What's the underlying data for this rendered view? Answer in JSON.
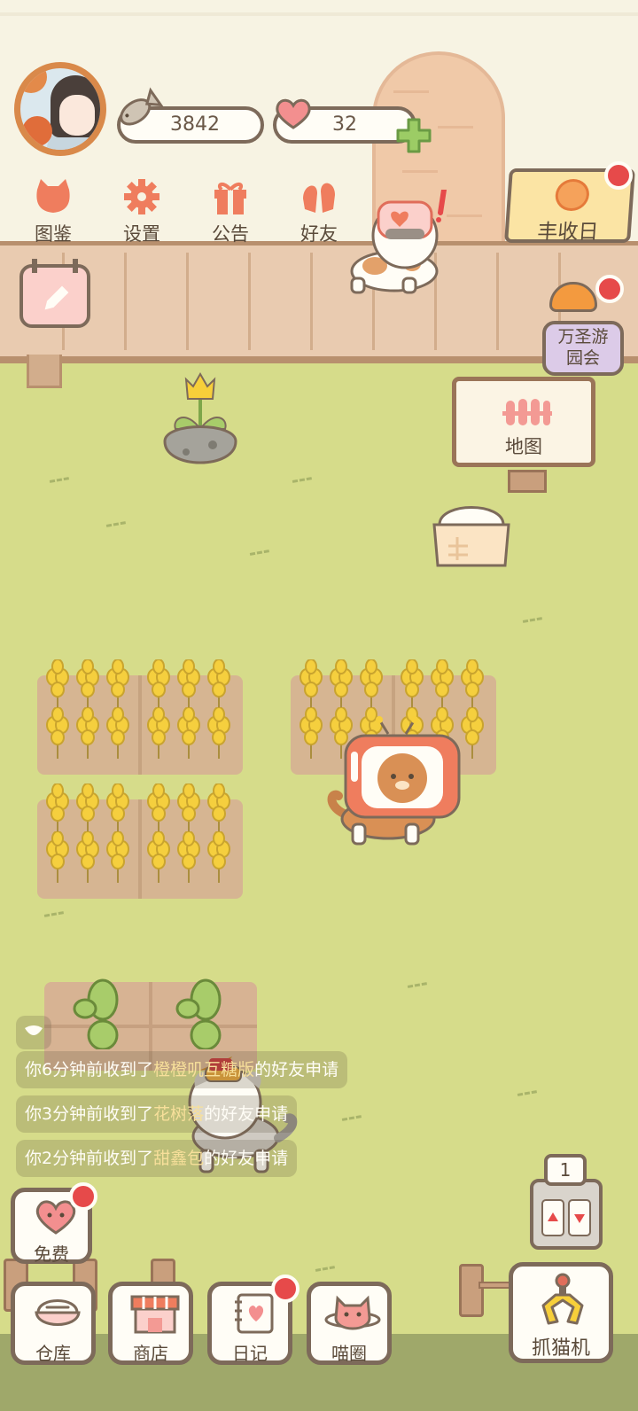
{
  "currency": {
    "fish": "3842",
    "hearts": "32"
  },
  "menu": [
    {
      "label": "图鉴",
      "icon": "cat-book-icon"
    },
    {
      "label": "设置",
      "icon": "gear-icon"
    },
    {
      "label": "公告",
      "icon": "gift-icon"
    },
    {
      "label": "好友",
      "icon": "friends-icon"
    }
  ],
  "events": {
    "harvest_day": "丰收日",
    "halloween": "万圣游园会"
  },
  "map_sign": "地图",
  "notifications": [
    {
      "prefix": "你6分钟前收到了",
      "name": "橙橙叽互糖版",
      "suffix": "的好友申请"
    },
    {
      "prefix": "你3分钟前收到了",
      "name": "花树落",
      "suffix": "的好友申请"
    },
    {
      "prefix": "你2分钟前收到了",
      "name": "甜鑫包",
      "suffix": "的好友申请"
    }
  ],
  "buttons": {
    "free": "免费",
    "warehouse": "仓库",
    "shop": "商店",
    "diary": "日记",
    "meow_circle": "喵圈",
    "claw_machine": "抓猫机"
  },
  "elevator_count": "1",
  "colors": {
    "accent": "#ef7d5e",
    "outline": "#7d6a5a",
    "grass": "#d6dc8a",
    "badge": "#e64a4a"
  }
}
